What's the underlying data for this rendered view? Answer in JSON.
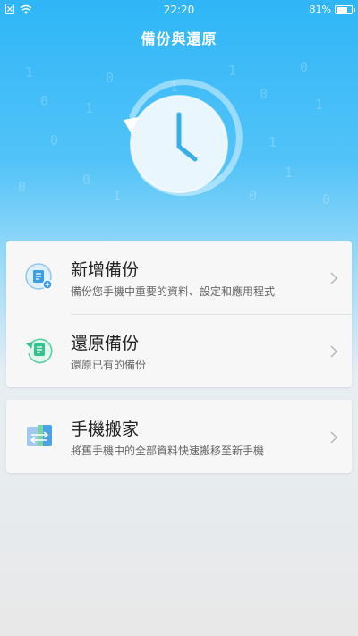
{
  "status": {
    "time": "22:20",
    "battery": "81%",
    "battery_level": 0.81
  },
  "header": {
    "title": "備份與還原"
  },
  "background_digits": [
    "1",
    "0",
    "1",
    "0",
    "0",
    "1",
    "0",
    "1",
    "0",
    "1",
    "1",
    "0",
    "0",
    "1",
    "0",
    "1",
    "0",
    "0",
    "1"
  ],
  "menu": {
    "new_backup": {
      "title": "新增備份",
      "subtitle": "備份您手機中重要的資料、設定和應用程式"
    },
    "restore_backup": {
      "title": "還原備份",
      "subtitle": "還原已有的備份"
    },
    "phone_clone": {
      "title": "手機搬家",
      "subtitle": "將舊手機中的全部資料快速搬移至新手機"
    }
  },
  "icons": {
    "sim": "no-sim-icon",
    "wifi": "wifi-icon",
    "battery": "battery-icon",
    "clock": "clock-backup-icon",
    "new_backup": "add-backup-icon",
    "restore": "restore-backup-icon",
    "clone": "phone-clone-icon",
    "chevron": "chevron-right-icon"
  },
  "colors": {
    "accent": "#2fb6f7",
    "new_icon": "#3a9fe8",
    "restore_icon": "#34c38f",
    "clone_icon": "#4aa3e9"
  }
}
